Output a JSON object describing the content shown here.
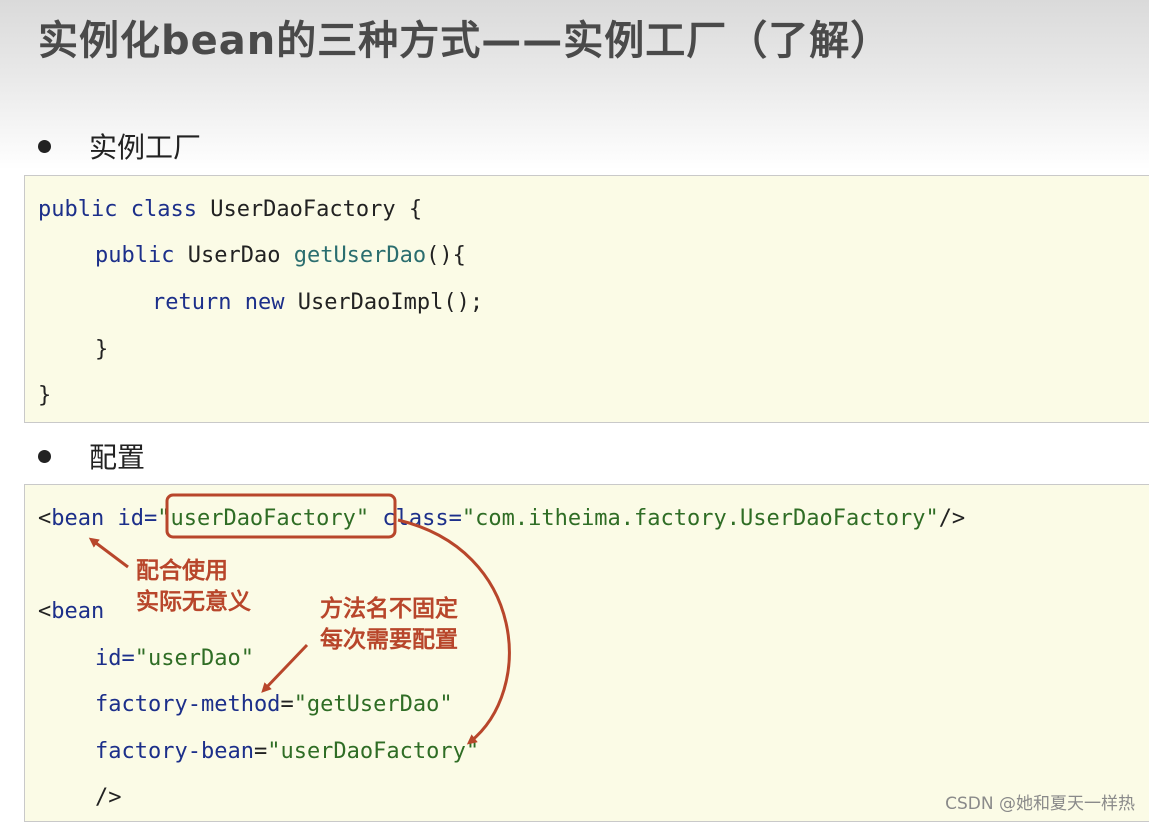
{
  "slide": {
    "title": "实例化bean的三种方式——实例工厂（了解）"
  },
  "bullets": [
    {
      "label": "实例工厂"
    },
    {
      "label": "配置"
    }
  ],
  "java_code": {
    "line1": {
      "kw": "public class",
      "rest": " UserDaoFactory {"
    },
    "line2": {
      "kw": "public",
      "type": " UserDao ",
      "method": "getUserDao",
      "rest": "(){"
    },
    "line3": {
      "kw": "return new",
      "rest": " UserDaoImpl();"
    },
    "line4": "}",
    "line5": "}"
  },
  "xml_config": {
    "line1": {
      "open": "<",
      "tag": "bean",
      "attr1": " id=",
      "val1": "\"userDaoFactory\"",
      "attr2": " class=",
      "val2": "\"com.itheima.factory.UserDaoFactory\"",
      "close": "/>"
    },
    "line2": {
      "open": "<",
      "tag": "bean"
    },
    "line3": {
      "attr": "id=",
      "val": "\"userDao\""
    },
    "line4": {
      "attr": "factory-method",
      "eq": "=",
      "val": "\"getUserDao\""
    },
    "line5": {
      "attr": "factory-bean",
      "eq": "=",
      "val": "\"userDaoFactory\""
    },
    "line6": "/>"
  },
  "annotations": {
    "note1_line1": "配合使用",
    "note1_line2": "实际无意义",
    "note2_line1": "方法名不固定",
    "note2_line2": "每次需要配置",
    "color": "#b8462b"
  },
  "watermark": "CSDN @她和夏天一样热"
}
